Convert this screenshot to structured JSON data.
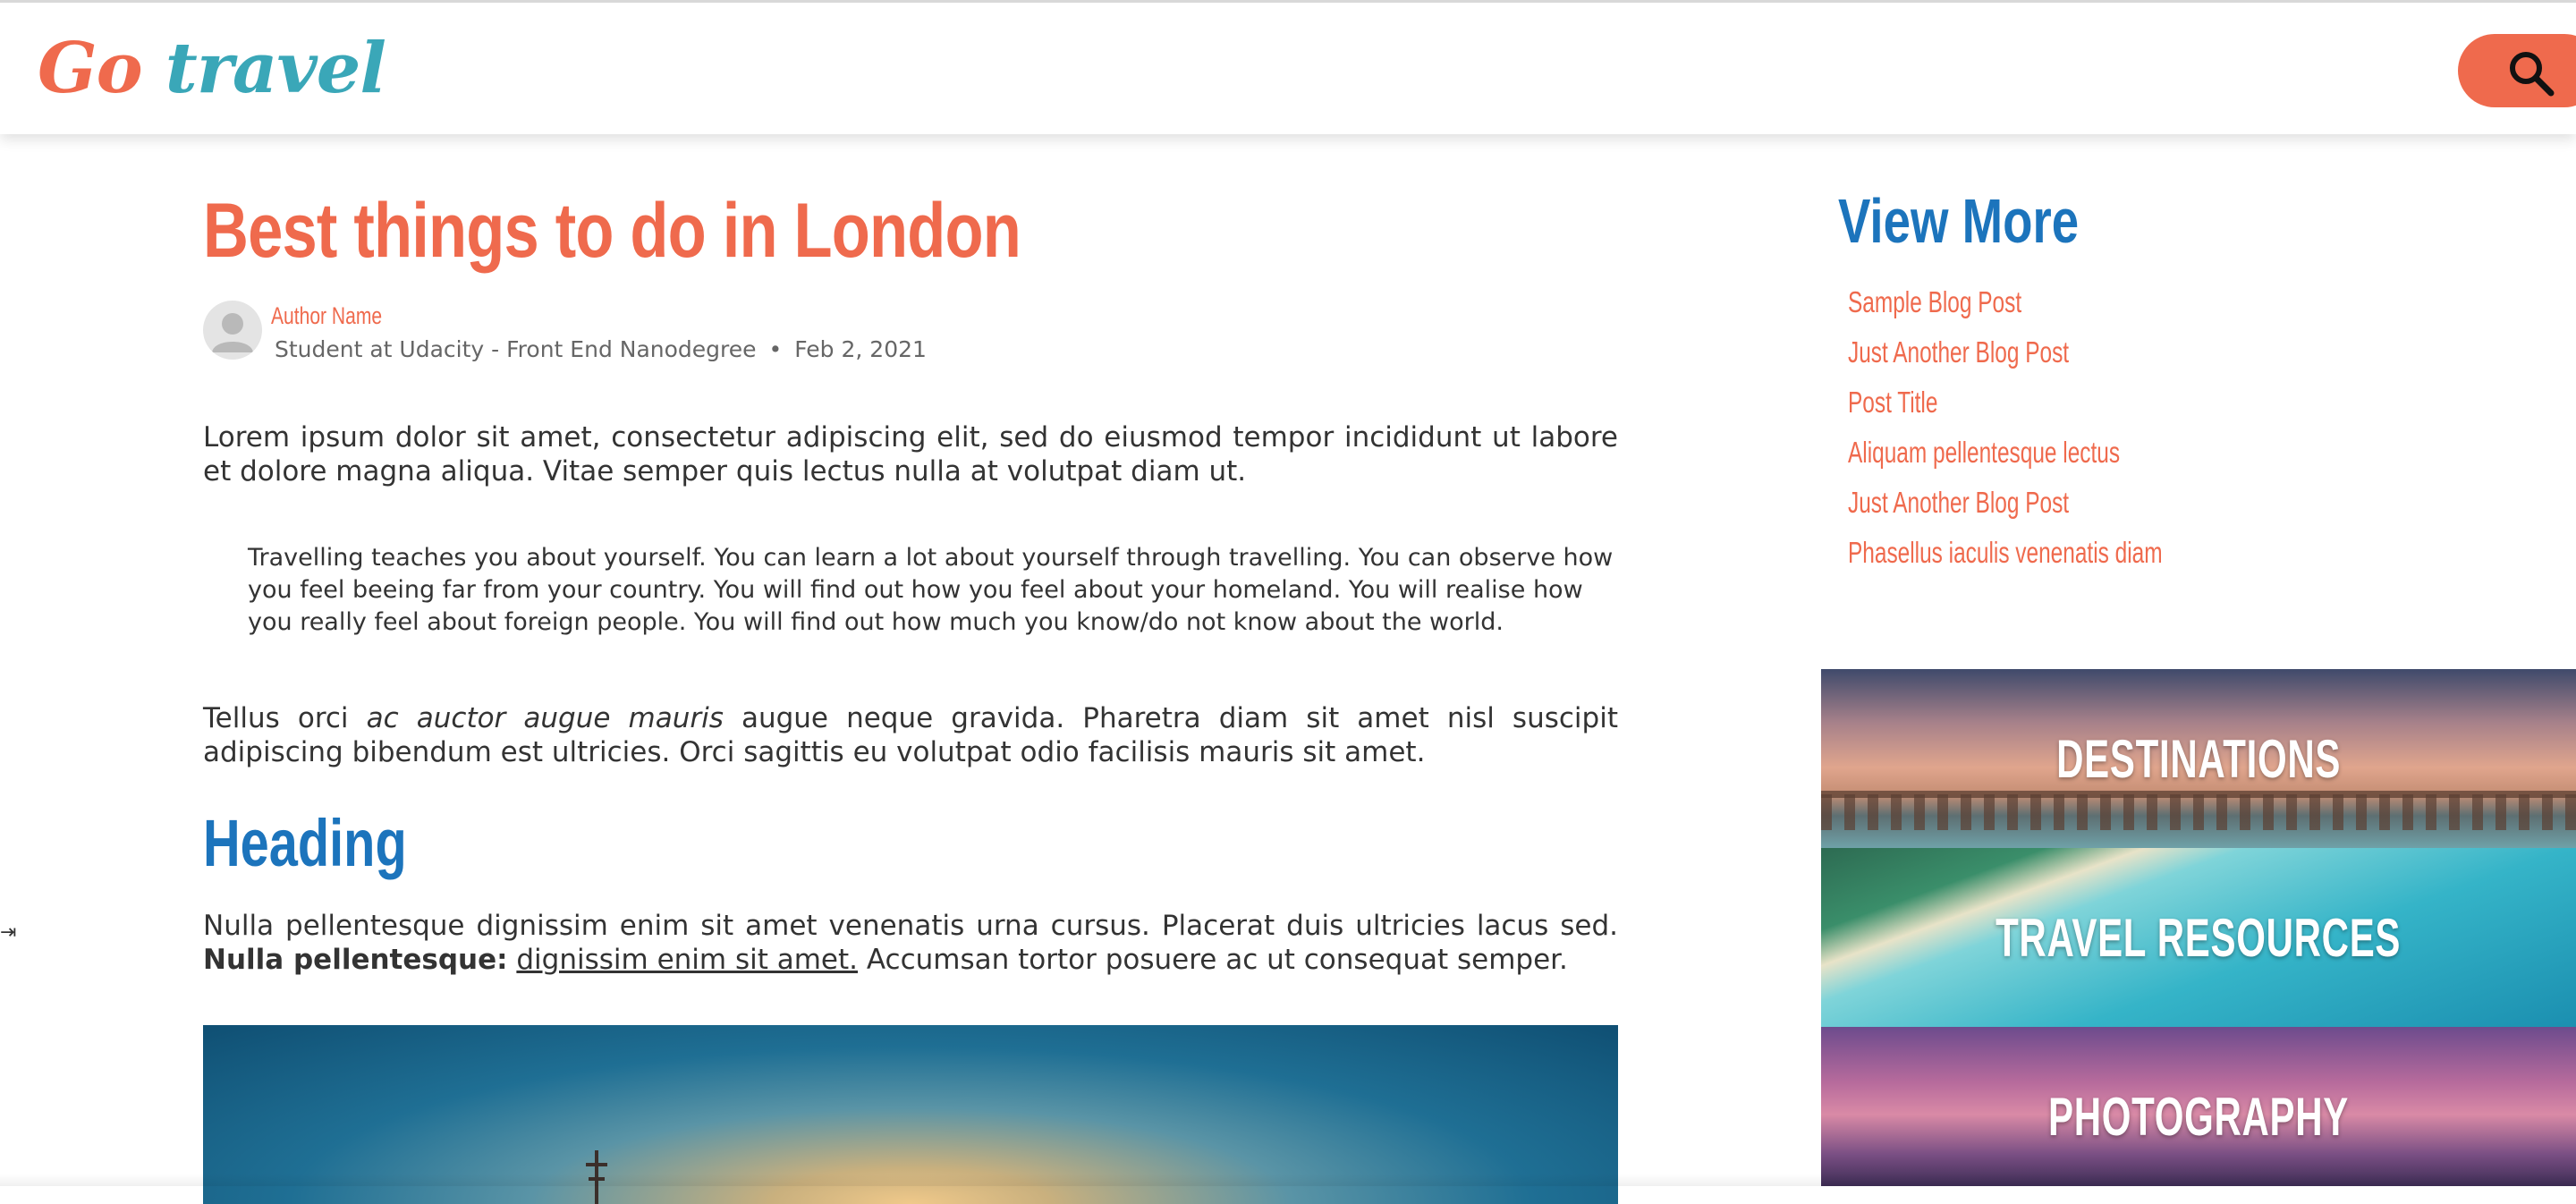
{
  "header": {
    "logo_go": "Go",
    "logo_travel": "travel",
    "search_icon": "search-icon",
    "brand_color": "#ef6a4d",
    "accent_color": "#3aa7b8"
  },
  "article": {
    "title": "Best things to do in London",
    "author": {
      "name": "Author Name",
      "role": "Student at Udacity - Front End Nanodegree",
      "separator": "•",
      "date": "Feb 2, 2021"
    },
    "p1": "Lorem ipsum dolor sit amet, consectetur adipiscing elit, sed do eiusmod tempor incididunt ut labore et dolore magna aliqua. Vitae semper quis lectus nulla at volutpat diam ut.",
    "quote": "Travelling teaches you about yourself. You can learn a lot about yourself through travelling. You can observe how you feel beeing far from your country. You will find out how you feel about your homeland. You will realise how you really feel about foreign people. You will find out how much you know/do not know about the world.",
    "p2": {
      "before": "Tellus orci ",
      "emphasis": "ac auctor augue mauris",
      "after": " augue neque gravida. Pharetra diam sit amet nisl suscipit adipiscing bibendum est ultricies. Orci sagittis eu volutpat odio facilisis mauris sit amet."
    },
    "heading": "Heading",
    "p3": {
      "before": "Nulla pellentesque dignissim enim sit amet venenatis urna cursus. Placerat duis ultricies lacus sed. ",
      "bold": "Nulla pellentesque:",
      "space": " ",
      "link": "dignissim enim sit amet.",
      "after": " Accumsan tortor posuere ac ut consequat semper."
    }
  },
  "sidebar": {
    "title": "View More",
    "links": [
      "Sample Blog Post",
      "Just Another Blog Post",
      "Post Title",
      "Aliquam pellentesque lectus",
      "Just Another Blog Post",
      "Phasellus iaculis venenatis diam"
    ],
    "categories": [
      "DESTINATIONS",
      "TRAVEL RESOURCES",
      "PHOTOGRAPHY"
    ],
    "heading_color": "#1c74bc"
  }
}
